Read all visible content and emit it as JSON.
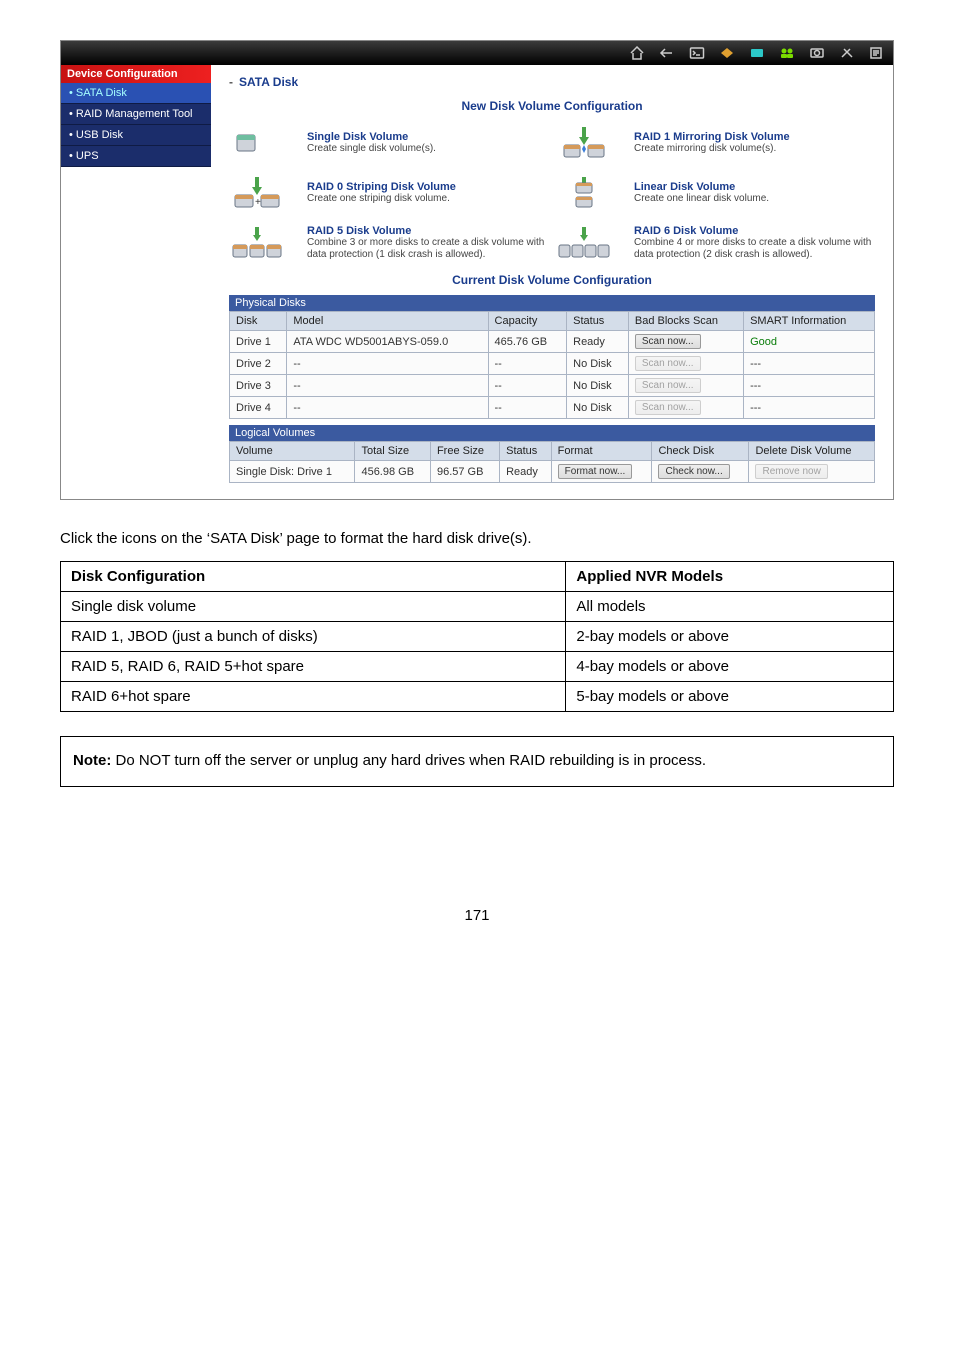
{
  "sidebar": {
    "header": "Device Configuration",
    "items": [
      {
        "label": "SATA Disk"
      },
      {
        "label": "RAID Management Tool"
      },
      {
        "label": "USB Disk"
      },
      {
        "label": "UPS"
      }
    ]
  },
  "crumb": {
    "dash": "-",
    "label": "SATA Disk"
  },
  "new_disk": {
    "title": "New Disk Volume Configuration",
    "options": [
      {
        "title": "Single Disk Volume",
        "desc": "Create single disk volume(s)."
      },
      {
        "title": "RAID 1 Mirroring Disk Volume",
        "desc": "Create mirroring disk volume(s)."
      },
      {
        "title": "RAID 0 Striping Disk Volume",
        "desc": "Create one striping disk volume."
      },
      {
        "title": "Linear Disk Volume",
        "desc": "Create one linear disk volume."
      },
      {
        "title": "RAID 5 Disk Volume",
        "desc": "Combine 3 or more disks to create a disk volume with data protection (1 disk crash is allowed)."
      },
      {
        "title": "RAID 6 Disk Volume",
        "desc": "Combine 4 or more disks to create a disk volume with data protection (2 disk crash is allowed)."
      }
    ]
  },
  "current": {
    "title": "Current Disk Volume Configuration",
    "phys_header": "Physical Disks",
    "phys_cols": {
      "disk": "Disk",
      "model": "Model",
      "capacity": "Capacity",
      "status": "Status",
      "bad": "Bad Blocks Scan",
      "smart": "SMART Information"
    },
    "phys_rows": [
      {
        "disk": "Drive 1",
        "model": "ATA WDC WD5001ABYS-059.0",
        "capacity": "465.76 GB",
        "status": "Ready",
        "scan": "Scan now...",
        "scan_dis": false,
        "smart": "Good"
      },
      {
        "disk": "Drive 2",
        "model": "--",
        "capacity": "--",
        "status": "No Disk",
        "scan": "Scan now...",
        "scan_dis": true,
        "smart": "---"
      },
      {
        "disk": "Drive 3",
        "model": "--",
        "capacity": "--",
        "status": "No Disk",
        "scan": "Scan now...",
        "scan_dis": true,
        "smart": "---"
      },
      {
        "disk": "Drive 4",
        "model": "--",
        "capacity": "--",
        "status": "No Disk",
        "scan": "Scan now...",
        "scan_dis": true,
        "smart": "---"
      }
    ],
    "log_header": "Logical Volumes",
    "log_cols": {
      "vol": "Volume",
      "total": "Total Size",
      "free": "Free Size",
      "status": "Status",
      "format": "Format",
      "check": "Check Disk",
      "del": "Delete Disk Volume"
    },
    "log_row": {
      "vol": "Single Disk: Drive 1",
      "total": "456.98 GB",
      "free": "96.57 GB",
      "status": "Ready",
      "format": "Format now...",
      "check": "Check now...",
      "del": "Remove now"
    }
  },
  "doc": {
    "intro": "Click the icons on the ‘SATA Disk’ page to format the hard disk drive(s).",
    "headers": {
      "left": "Disk Configuration",
      "right": "Applied NVR Models"
    },
    "rows": [
      {
        "left": "Single disk volume",
        "right": "All models"
      },
      {
        "left": "RAID 1, JBOD (just a bunch of disks)",
        "right": "2-bay models or above"
      },
      {
        "left": "RAID 5, RAID 6, RAID 5+hot spare",
        "right": "4-bay models or above"
      },
      {
        "left": "RAID 6+hot spare",
        "right": "5-bay models or above"
      }
    ],
    "note_bold": "Note:",
    "note_rest": " Do NOT turn off the server or unplug any hard drives when RAID rebuilding is in process.",
    "pagenum": "171"
  }
}
